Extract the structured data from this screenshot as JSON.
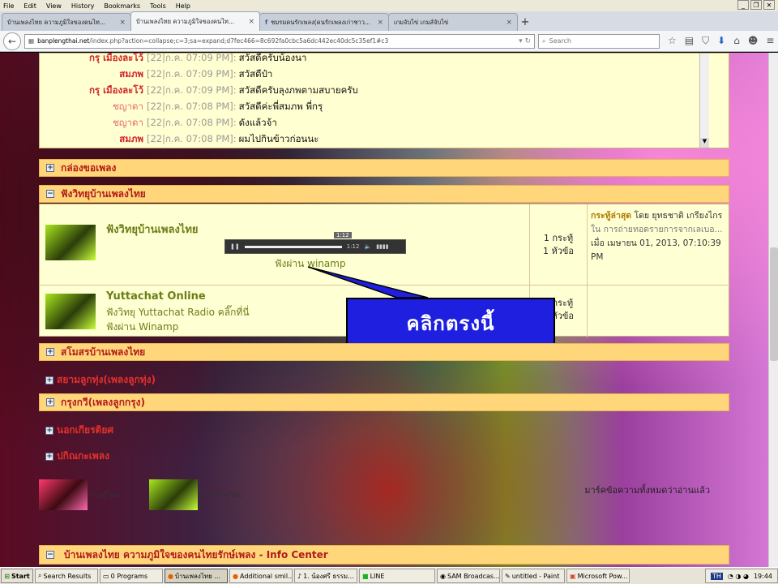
{
  "menubar": {
    "items": [
      "File",
      "Edit",
      "View",
      "History",
      "Bookmarks",
      "Tools",
      "Help"
    ]
  },
  "tabs": [
    {
      "label": "บ้านเพลงไทย ความภูมิใจของคนไท..."
    },
    {
      "label": "บ้านเพลงไทย ความภูมิใจของคนไท..."
    },
    {
      "label": "ชมรมคนรักเพลง(คนรักเพลงเก่าชาว..."
    },
    {
      "label": "เกมจับไข่ เกมส์จับไข่"
    }
  ],
  "url": {
    "host": "banplengthai.net",
    "path": "/index.php?action=collapse;c=3;sa=expand;d7fec466=8c692fa0cbc5a6dc442ec40dc5c35ef1#c3"
  },
  "search": {
    "placeholder": "Search"
  },
  "chat": [
    {
      "who": "กรุ เมืองละโว้",
      "ts": "[22|ก.ค. 07:09 PM]:",
      "msg": "สวัสดีครับน้องนา",
      "pink": false
    },
    {
      "who": "สมภพ",
      "ts": "[22|ก.ค. 07:09 PM]:",
      "msg": "สวัสดีป๋า",
      "pink": false
    },
    {
      "who": "กรุ เมืองละโว้",
      "ts": "[22|ก.ค. 07:09 PM]:",
      "msg": "สวัสดีครับลุงภพตามสบายครับ",
      "pink": false
    },
    {
      "who": "ชญาดา",
      "ts": "[22|ก.ค. 07:08 PM]:",
      "msg": "สวัสดีค่ะพี่สมภพ พี่กรุ",
      "pink": true
    },
    {
      "who": "ชญาดา",
      "ts": "[22|ก.ค. 07:08 PM]:",
      "msg": "ดังแล้วจ้า",
      "pink": true
    },
    {
      "who": "สมภพ",
      "ts": "[22|ก.ค. 07:08 PM]:",
      "msg": "ผมไปกินข้าวก่อนนะ",
      "pink": false
    }
  ],
  "categories": {
    "songbox": "กล่องขอเพลง",
    "radio": "ฟังวิทยุบ้านเพลงไทย",
    "club": "สโมสรบ้านเพลงไทย",
    "luktung": "สยามลูกทุ่ง(เพลงลูกทุ่ง)",
    "luk_krung": "กรุงกวี(เพลงลูกกรุง)",
    "off": "นอกเกียรติยศ",
    "misc": "ปกิณกะเพลง",
    "info": "บ้านเพลงไทย ความภูมิใจของคนไทยรักษ์เพลง - Info Center"
  },
  "boards": [
    {
      "name": "ฟังวิทยุบ้านเพลงไทย",
      "desc": "ฟังผ่าน winamp",
      "player_time": "1:12",
      "player_tip": "1:12",
      "topics": "1 กระทู้",
      "posts": "1 หัวข้อ",
      "last_label": "กระทู้ล่าสุด",
      "last_by": "โดย ยุทธชาติ เกรียงไกร",
      "last_in": "ใน การถ่ายทอดรายการจากเลเบอ...",
      "last_when": "เมื่อ เมษายน 01, 2013, 07:10:39 PM"
    },
    {
      "name": "Yuttachat Online",
      "desc": "ฟังวิทยุ Yuttachat Radio คลิ๊กที่นี่",
      "desc2": "ฟังผ่าน Winamp",
      "topics": "0 กระทู้",
      "posts": "0 หัวข้อ"
    }
  ],
  "callout": "คลิกตรงนี้",
  "legend": {
    "new": "กระทู้ใหม่",
    "nonew": "ไม่มีกระทู้ใหม่",
    "markall": "มาร์คข้อความทั้งหมดว่าอ่านแล้ว"
  },
  "taskbar": {
    "start": "Start",
    "items": [
      "Search Results",
      "0 Programs",
      "บ้านเพลงไทย ...",
      "Additional smil...",
      "1. น้องศรี ธรรม...",
      "LINE",
      "SAM Broadcas...",
      "untitled - Paint",
      "Microsoft Pow..."
    ],
    "tray": "TH",
    "time": "19:44"
  }
}
